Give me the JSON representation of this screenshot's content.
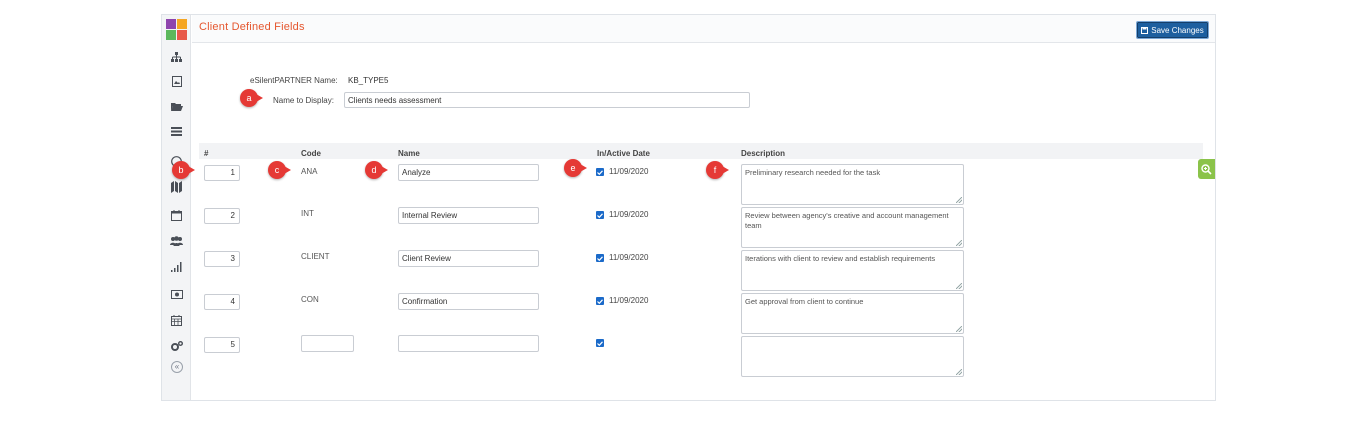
{
  "header": {
    "title": "Client Defined Fields",
    "save_label": "Save Changes"
  },
  "form": {
    "partner_name_label": "eSilentPARTNER Name:",
    "partner_name_value": "KB_TYPE5",
    "display_name_label": "Name to Display:",
    "display_name_value": "Clients needs assessment"
  },
  "table": {
    "columns": [
      "#",
      "Code",
      "Name",
      "In/Active Date",
      "Description"
    ],
    "rows": [
      {
        "num": "1",
        "code": "ANA",
        "name": "Analyze",
        "active": true,
        "date": "11/09/2020",
        "description": "Preliminary research needed for the task"
      },
      {
        "num": "2",
        "code": "INT",
        "name": "Internal Review",
        "active": true,
        "date": "11/09/2020",
        "description": "Review between agency's creative and account management team"
      },
      {
        "num": "3",
        "code": "CLIENT",
        "name": "Client Review",
        "active": true,
        "date": "11/09/2020",
        "description": "Iterations with client to review and establish requirements"
      },
      {
        "num": "4",
        "code": "CON",
        "name": "Confirmation",
        "active": true,
        "date": "11/09/2020",
        "description": "Get approval from client to continue"
      },
      {
        "num": "5",
        "code": "",
        "name": "",
        "active": true,
        "date": "",
        "description": ""
      }
    ]
  },
  "callouts": [
    "a",
    "b",
    "c",
    "d",
    "e",
    "f"
  ],
  "sidebar": {
    "icons": [
      "sitemap-icon",
      "image-icon",
      "folder-open-icon",
      "list-icon",
      "clock-icon",
      "map-icon",
      "calendar-icon",
      "users-icon",
      "bar-chart-icon",
      "money-icon",
      "calendar-grid-icon",
      "cogs-icon"
    ],
    "collapse_label": "«"
  },
  "colors": {
    "title": "#e5572f",
    "save_button": "#1d5f9f",
    "callout": "#e53935",
    "checkbox": "#1b6ac9",
    "zoom": "#8bc34a"
  }
}
